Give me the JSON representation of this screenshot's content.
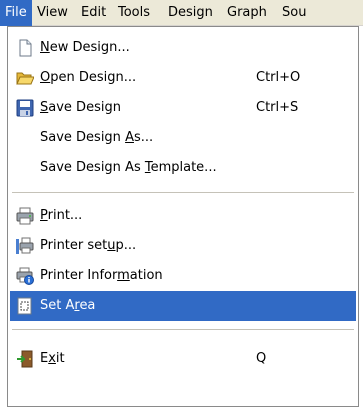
{
  "menubar": {
    "items": [
      {
        "label": "File",
        "active": true
      },
      {
        "label": "View"
      },
      {
        "label": "Edit"
      },
      {
        "label": "Tools"
      },
      {
        "label": "Design"
      },
      {
        "label": "Graph"
      },
      {
        "label": "Sou"
      }
    ]
  },
  "file_menu": {
    "items": [
      {
        "pre": "",
        "mn": "N",
        "post": "ew Design...",
        "accel": "",
        "icon": "new-document-icon"
      },
      {
        "pre": "",
        "mn": "O",
        "post": "pen Design...",
        "accel": "Ctrl+O",
        "icon": "open-folder-icon"
      },
      {
        "pre": "",
        "mn": "S",
        "post": "ave Design",
        "accel": "Ctrl+S",
        "icon": "floppy-disk-icon"
      },
      {
        "pre": "Save Design ",
        "mn": "A",
        "post": "s...",
        "accel": "",
        "icon": ""
      },
      {
        "pre": "Save Design As ",
        "mn": "T",
        "post": "emplate...",
        "accel": "",
        "icon": ""
      },
      {
        "pre": "",
        "mn": "P",
        "post": "rint...",
        "accel": "",
        "icon": "printer-icon"
      },
      {
        "pre": "Printer set",
        "mn": "u",
        "post": "p...",
        "accel": "",
        "icon": "printer-setup-icon"
      },
      {
        "pre": "Printer Infor",
        "mn": "m",
        "post": "ation",
        "accel": "",
        "icon": "printer-info-icon"
      },
      {
        "pre": "Set A",
        "mn": "r",
        "post": "ea",
        "accel": "",
        "icon": "set-area-icon",
        "highlighted": true
      },
      {
        "pre": "E",
        "mn": "x",
        "post": "it",
        "accel": "Q",
        "icon": "exit-door-icon"
      }
    ]
  },
  "colors": {
    "menubar_bg": "#ece9d8",
    "highlight": "#316ac5",
    "menu_bg": "#ffffff",
    "separator": "#c5c2b8"
  }
}
